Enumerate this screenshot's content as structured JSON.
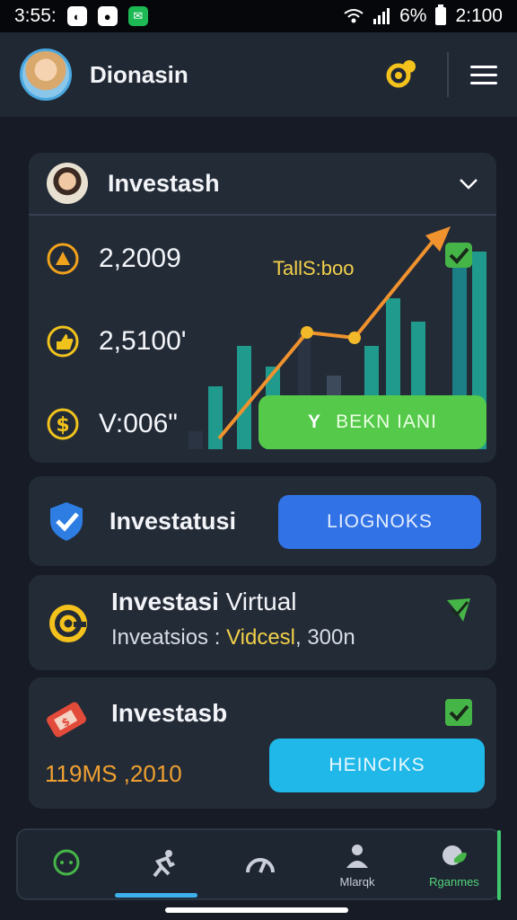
{
  "status_bar": {
    "time": "3:55:",
    "battery": "6%",
    "clock_right": "2:100"
  },
  "header": {
    "title": "Dionasin"
  },
  "investment_card": {
    "title": "Investash",
    "stats": [
      "2,2009",
      "2,5100'",
      "V:006\""
    ],
    "chart_label": "TallS:boo",
    "button_label": "BEKN IANI",
    "colors": {
      "teal": "#1f9a8c",
      "orange": "#f0922e",
      "green": "#55c94a"
    }
  },
  "card2": {
    "label": "Investatusi",
    "button_label": "LIOGNOKS"
  },
  "card3": {
    "title_bold": "Investasi",
    "title_rest": " Virtual",
    "sub_prefix": "Inveatsios : ",
    "sub_value": "Vidcesl",
    "sub_suffix": ", 300n"
  },
  "card4": {
    "title": "Investasb",
    "amount": "119MS ,2010",
    "button_label": "HEINCIKS"
  },
  "bottom_nav": [
    {
      "label": "",
      "icon": "chat-bubble-icon"
    },
    {
      "label": "",
      "icon": "runner-icon"
    },
    {
      "label": "",
      "icon": "gauge-icon"
    },
    {
      "label": "Mlarqk",
      "icon": "person-icon"
    },
    {
      "label": "Rganmes",
      "icon": "globe-leaf-icon"
    }
  ]
}
